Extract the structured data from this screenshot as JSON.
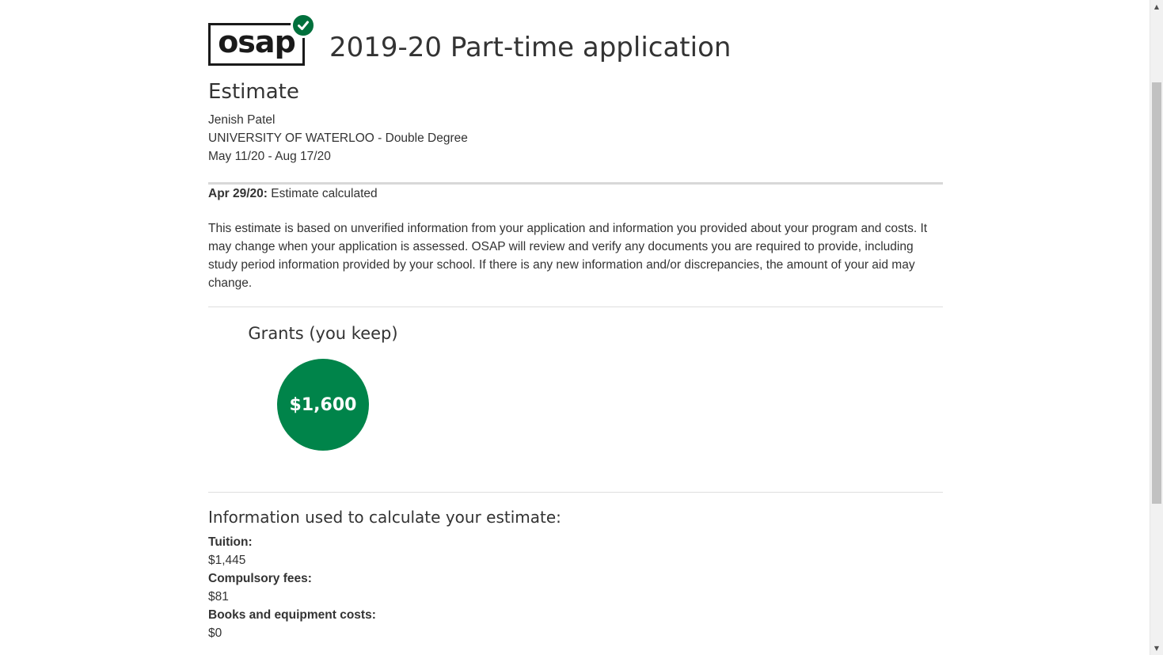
{
  "logo": {
    "text": "osap"
  },
  "header": {
    "title": "2019-20 Part-time application"
  },
  "estimate": {
    "heading": "Estimate",
    "student_name": "Jenish Patel",
    "program": "UNIVERSITY OF WATERLOO - Double Degree",
    "study_period": "May 11/20 - Aug 17/20"
  },
  "status": {
    "date": "Apr 29/20:",
    "text": "Estimate calculated"
  },
  "disclaimer": "This estimate is based on unverified information from your application and information you provided about your program and costs. It may change when your application is assessed. OSAP will review and verify any documents you are required to provide, including study period information provided by your school. If there is any new information and/or discrepancies, the amount of your aid may change.",
  "grants": {
    "title": "Grants (you keep)",
    "amount": "$1,600",
    "color": "#00844a"
  },
  "info": {
    "title": "Information used to calculate your estimate:",
    "items": [
      {
        "label": "Tuition:",
        "value": "$1,445"
      },
      {
        "label": "Compulsory fees:",
        "value": "$81"
      },
      {
        "label": "Books and equipment costs:",
        "value": "$0"
      }
    ]
  },
  "colors": {
    "brand_green": "#00703c",
    "text": "#333333",
    "divider": "#d8d8d8"
  }
}
